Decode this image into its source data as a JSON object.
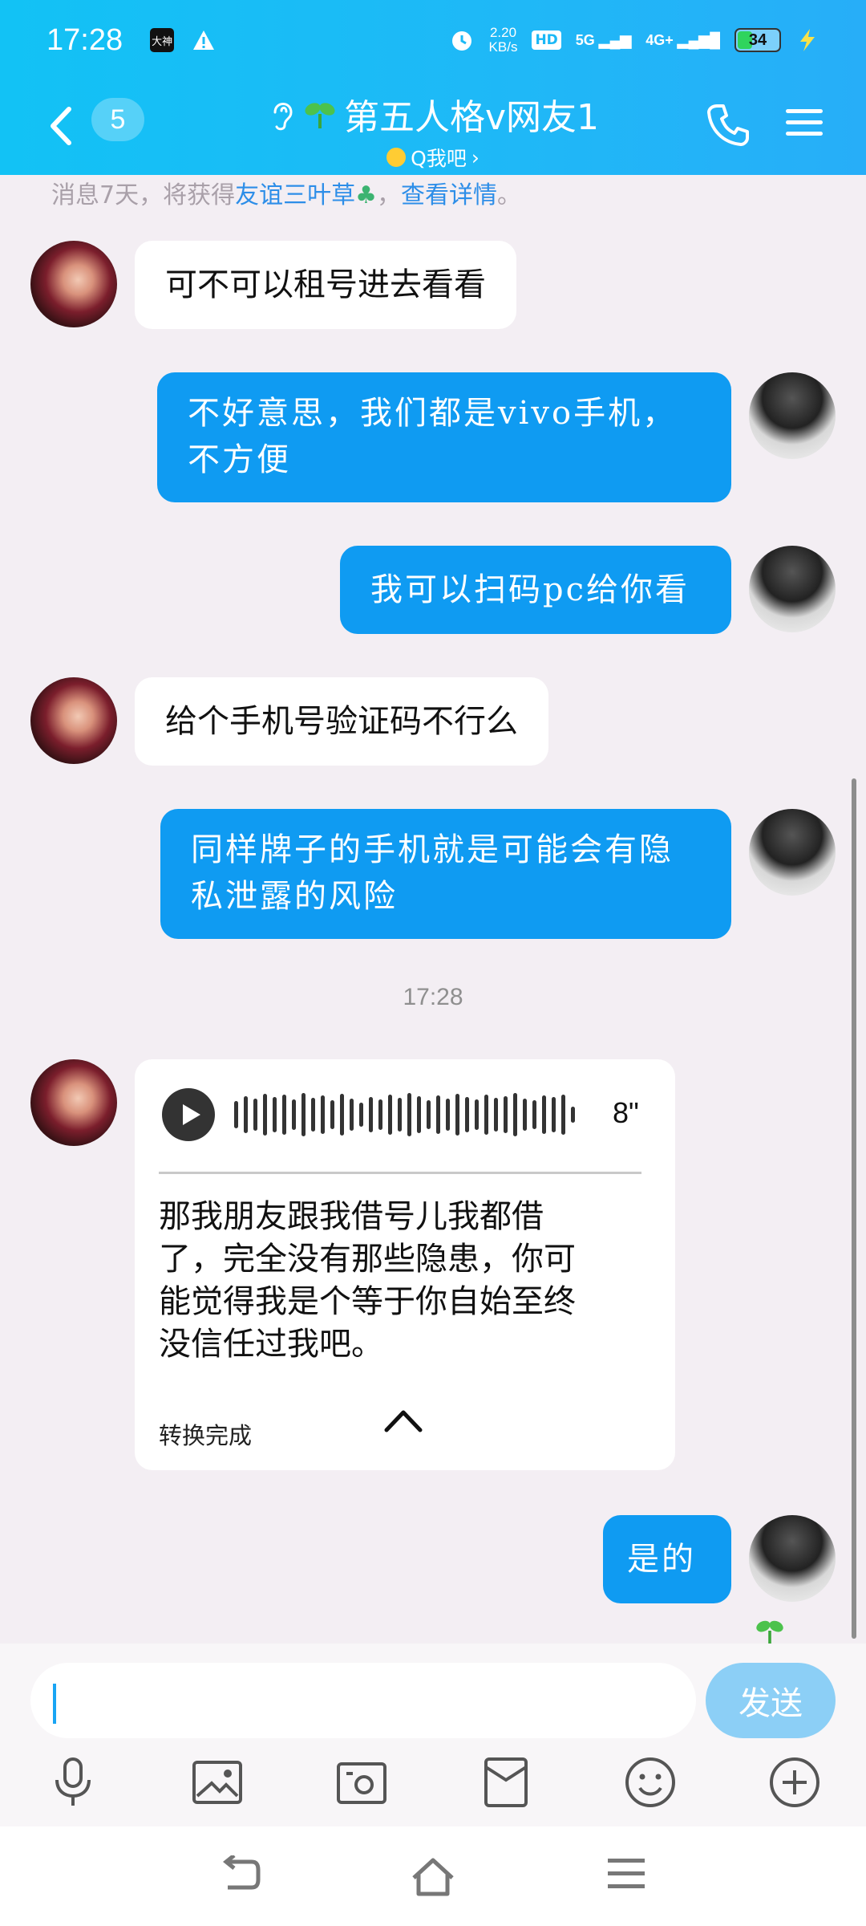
{
  "status_bar": {
    "time": "17:28",
    "app_badge": "大神",
    "net_speed_value": "2.20",
    "net_speed_unit": "KB/s",
    "hd_label": "HD",
    "sim1_label": "5G",
    "sim2_label": "4G+",
    "battery": "34"
  },
  "header": {
    "unread_count": "5",
    "title": "第五人格v网友1",
    "subtitle": "Q我吧",
    "subtitle_chevron": "›"
  },
  "system_note": {
    "prefix": "消息7天，将获得",
    "link1": "友谊三叶草",
    "middle": "，",
    "link2": "查看详情",
    "suffix": "。"
  },
  "messages": [
    {
      "side": "in",
      "text": "可不可以租号进去看看"
    },
    {
      "side": "out",
      "line1": "不好意思，我们都是vivo手机，",
      "line2": "不方便"
    },
    {
      "side": "out",
      "text": "我可以扫码pc给你看"
    },
    {
      "side": "in",
      "text": "给个手机号验证码不行么"
    },
    {
      "side": "out",
      "line1": "同样牌子的手机就是可能会有隐",
      "line2": "私泄露的风险"
    },
    {
      "side": "out",
      "text": "是的"
    }
  ],
  "timestamp": "17:28",
  "voice_message": {
    "duration": "8\"",
    "transcript_line1": "那我朋友跟我借号儿我都借",
    "transcript_line2": "了，完全没有那些隐患，你可",
    "transcript_line3": "能觉得我是个等于你自始至终",
    "transcript_line4": "没信任过我吧。",
    "convert_status": "转换完成"
  },
  "input": {
    "value": "",
    "placeholder": "",
    "send_label": "发送"
  },
  "toolbar_icons": [
    "microphone-icon",
    "image-icon",
    "camera-icon",
    "red-packet-icon",
    "emoji-icon",
    "plus-icon"
  ],
  "colors": {
    "header_bg": "#1fb8f7",
    "outgoing_bubble": "#0f9bf2",
    "incoming_bubble": "#ffffff",
    "chat_bg": "#f3eef3",
    "send_button": "#8ccff6"
  }
}
